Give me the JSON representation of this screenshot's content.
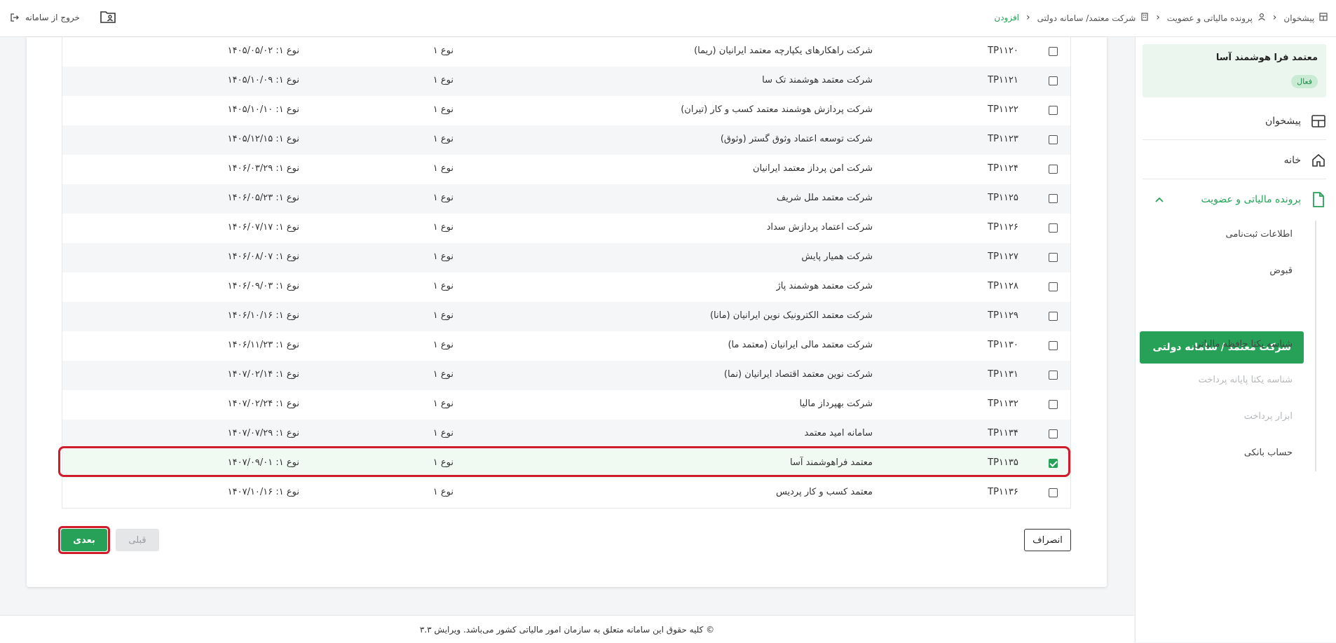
{
  "topbar": {
    "breadcrumbs": [
      "پیشخوان",
      "پرونده مالیاتی و عضویت",
      "شرکت معتمد/ سامانه دولتی",
      "افزودن"
    ],
    "exit_label": "خروج از سامانه"
  },
  "sidebar": {
    "user_name": "معتمد فرا هوشمند آسا",
    "status": "فعال",
    "items": [
      {
        "label": "پیشخوان",
        "icon": "dashboard-icon"
      },
      {
        "label": "خانه",
        "icon": "home-icon"
      },
      {
        "label": "پرونده مالیاتی و عضویت",
        "icon": "file-icon"
      }
    ],
    "sub_items": [
      {
        "label": "اطلاعات ثبت‌نامی",
        "disabled": false
      },
      {
        "label": "قبوض",
        "disabled": false
      },
      {
        "label": "شرکت معتمد / سامانه دولتی",
        "active": true
      },
      {
        "label": "شناسه یکتا حافظه مالیاتی",
        "disabled": false
      },
      {
        "label": "شناسه یکتا پایانه پرداخت",
        "disabled": true
      },
      {
        "label": "ابزار پرداخت",
        "disabled": true
      },
      {
        "label": "حساب بانکی",
        "disabled": false
      }
    ]
  },
  "table": {
    "rows": [
      {
        "code": "TP۱۱۲۰",
        "name": "شرکت راهکارهای یکپارچه معتمد ایرانیان (ریما)",
        "type": "نوع ۱",
        "expiry": "نوع ۱: ۱۴۰۵/۰۵/۰۲",
        "checked": false
      },
      {
        "code": "TP۱۱۲۱",
        "name": "شرکت معتمد هوشمند تک سا",
        "type": "نوع ۱",
        "expiry": "نوع ۱: ۱۴۰۵/۱۰/۰۹",
        "checked": false
      },
      {
        "code": "TP۱۱۲۲",
        "name": "شرکت پردازش هوشمند معتمد کسب و کار (تیران)",
        "type": "نوع ۱",
        "expiry": "نوع ۱: ۱۴۰۵/۱۰/۱۰",
        "checked": false
      },
      {
        "code": "TP۱۱۲۳",
        "name": "شرکت توسعه اعتماد وثوق گستر (وثوق)",
        "type": "نوع ۱",
        "expiry": "نوع ۱: ۱۴۰۵/۱۲/۱۵",
        "checked": false
      },
      {
        "code": "TP۱۱۲۴",
        "name": "شرکت امن پرداز معتمد ایرانیان",
        "type": "نوع ۱",
        "expiry": "نوع ۱: ۱۴۰۶/۰۳/۲۹",
        "checked": false
      },
      {
        "code": "TP۱۱۲۵",
        "name": "شرکت معتمد ملل شریف",
        "type": "نوع ۱",
        "expiry": "نوع ۱: ۱۴۰۶/۰۵/۲۳",
        "checked": false
      },
      {
        "code": "TP۱۱۲۶",
        "name": "شرکت اعتماد پردازش سداد",
        "type": "نوع ۱",
        "expiry": "نوع ۱: ۱۴۰۶/۰۷/۱۷",
        "checked": false
      },
      {
        "code": "TP۱۱۲۷",
        "name": "شرکت همیار پایش",
        "type": "نوع ۱",
        "expiry": "نوع ۱: ۱۴۰۶/۰۸/۰۷",
        "checked": false
      },
      {
        "code": "TP۱۱۲۸",
        "name": "شرکت معتمد هوشمند پاژ",
        "type": "نوع ۱",
        "expiry": "نوع ۱: ۱۴۰۶/۰۹/۰۳",
        "checked": false
      },
      {
        "code": "TP۱۱۲۹",
        "name": "شرکت معتمد الکترونیک نوین ایرانیان (مانا)",
        "type": "نوع ۱",
        "expiry": "نوع ۱: ۱۴۰۶/۱۰/۱۶",
        "checked": false
      },
      {
        "code": "TP۱۱۳۰",
        "name": "شرکت معتمد مالی ایرانیان (معتمد ما)",
        "type": "نوع ۱",
        "expiry": "نوع ۱: ۱۴۰۶/۱۱/۲۳",
        "checked": false
      },
      {
        "code": "TP۱۱۳۱",
        "name": "شرکت نوین معتمد اقتصاد ایرانیان (نما)",
        "type": "نوع ۱",
        "expiry": "نوع ۱: ۱۴۰۷/۰۲/۱۴",
        "checked": false
      },
      {
        "code": "TP۱۱۳۲",
        "name": "شرکت بهپرداز مالیا",
        "type": "نوع ۱",
        "expiry": "نوع ۱: ۱۴۰۷/۰۲/۲۴",
        "checked": false
      },
      {
        "code": "TP۱۱۳۴",
        "name": "سامانه امید معتمد",
        "type": "نوع ۱",
        "expiry": "نوع ۱: ۱۴۰۷/۰۷/۲۹",
        "checked": false
      },
      {
        "code": "TP۱۱۳۵",
        "name": "معتمد فراهوشمند آسا",
        "type": "نوع ۱",
        "expiry": "نوع ۱: ۱۴۰۷/۰۹/۰۱",
        "checked": true
      },
      {
        "code": "TP۱۱۳۶",
        "name": "معتمد کسب و کار پردیس",
        "type": "نوع ۱",
        "expiry": "نوع ۱: ۱۴۰۷/۱۰/۱۶",
        "checked": false
      }
    ]
  },
  "actions": {
    "cancel": "انصراف",
    "prev": "قبلی",
    "next": "بعدی"
  },
  "footer": {
    "text": "© کلیه حقوق این سامانه متعلق به سازمان امور مالیاتی کشور می‌باشد. ویرایش ۳.۳"
  },
  "colors": {
    "accent": "#27a158",
    "highlight": "#d01b2a"
  }
}
